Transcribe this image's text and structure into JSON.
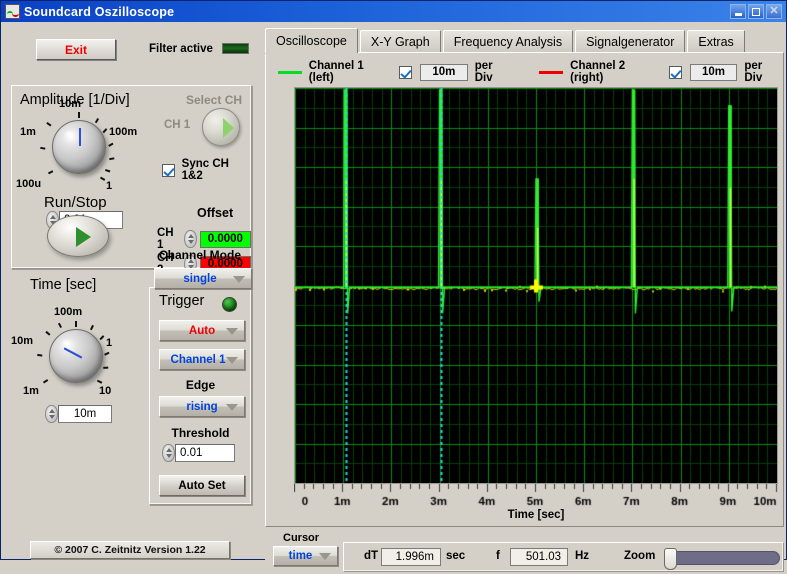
{
  "window": {
    "title": "Soundcard Oszilloscope",
    "icon": "oscilloscope-icon",
    "minimize": "minimize-icon",
    "maximize": "maximize-icon",
    "close": "close-icon"
  },
  "toolbar": {
    "exit_label": "Exit",
    "filter_label": "Filter active",
    "filter_led": "filter-led-off"
  },
  "amplitude": {
    "title": "Amplitude [1/Div]",
    "dial_labels": [
      "1m",
      "10m",
      "100m",
      "1",
      "100u"
    ],
    "value": "0.01",
    "select_ch_title": "Select CH",
    "select_ch_value": "CH 1",
    "sync_label": "Sync CH 1&2",
    "sync_checked": true,
    "offset_title": "Offset",
    "offsets": [
      {
        "label": "CH 1",
        "value": "0.0000",
        "color": "#00ff00"
      },
      {
        "label": "CH 2",
        "value": "0.0000",
        "color": "#ff0000"
      }
    ]
  },
  "time": {
    "title": "Time [sec]",
    "dial_labels": [
      "10m",
      "100m",
      "1",
      "10",
      "1m"
    ],
    "value": "10m"
  },
  "trigger": {
    "title": "Trigger",
    "led": "trigger-led-on",
    "mode": "Auto",
    "mode_color": "#ee0000",
    "source": "Channel 1",
    "source_color": "#0044dd",
    "edge_label": "Edge",
    "edge": "rising",
    "edge_color": "#0044dd",
    "threshold_label": "Threshold",
    "threshold": "0.01",
    "autoset_label": "Auto Set"
  },
  "runstop": {
    "label": "Run/Stop"
  },
  "channel_mode": {
    "label": "Channel Mode",
    "value": "single",
    "value_color": "#0044dd"
  },
  "footer": {
    "copyright": "© 2007   C. Zeitnitz Version 1.22"
  },
  "tabs": [
    {
      "label": "Oscilloscope",
      "active": true
    },
    {
      "label": "X-Y Graph",
      "active": false
    },
    {
      "label": "Frequency Analysis",
      "active": false
    },
    {
      "label": "Signalgenerator",
      "active": false
    },
    {
      "label": "Extras",
      "active": false
    }
  ],
  "channels": [
    {
      "name": "Channel 1 (left)",
      "color": "#00dd22",
      "enabled": true,
      "per_div_value": "10m",
      "per_div_label": "per Div"
    },
    {
      "name": "Channel 2 (right)",
      "color": "#ee0000",
      "enabled": true,
      "per_div_value": "10m",
      "per_div_label": "per Div"
    }
  ],
  "status": {
    "cursor_label": "Cursor",
    "cursor_mode": "time",
    "cursor_mode_color": "#0044dd",
    "dt_label": "dT",
    "dt_value": "1.996m",
    "dt_unit": "sec",
    "f_label": "f",
    "f_value": "501.03",
    "f_unit": "Hz",
    "zoom_label": "Zoom",
    "zoom_position": 0
  },
  "chart_data": {
    "type": "line",
    "title": "",
    "xlabel": "Time [sec]",
    "ylabel": "",
    "xlim": [
      0,
      0.01
    ],
    "x_tick_labels": [
      "0",
      "1m",
      "2m",
      "3m",
      "4m",
      "5m",
      "6m",
      "7m",
      "8m",
      "9m",
      "10m"
    ],
    "x_tick_values": [
      0,
      0.001,
      0.002,
      0.003,
      0.004,
      0.005,
      0.006,
      0.007,
      0.008,
      0.009,
      0.01
    ],
    "grid": true,
    "grid_major_color": "#0a8f12",
    "grid_minor_color": "#063f09",
    "background": "#000000",
    "divisions_x": 10,
    "divisions_y": 10,
    "baseline_y_frac": 0.505,
    "series": [
      {
        "name": "Channel 1 (left)",
        "color": "#2fee2f",
        "spikes_time": [
          0.00105,
          0.00302,
          0.00502,
          0.00702,
          0.00902
        ],
        "spike_amplitude_frac": [
          1.0,
          1.0,
          0.55,
          1.0,
          0.92
        ],
        "description": "periodic narrow pulses, period approx 2ms, 501 Hz"
      },
      {
        "name": "Channel 2 (right)",
        "color": "#cccc00",
        "spikes_time": [
          0.00502
        ],
        "spike_amplitude_frac": [
          0.12
        ],
        "description": "low-level noisy flat trace near baseline"
      }
    ],
    "cursors": [
      {
        "name": "cursor-1",
        "time": 0.00105,
        "color": "#22dddd"
      },
      {
        "name": "cursor-2",
        "time": 0.00302,
        "color": "#22dddd"
      }
    ],
    "cursor_marker": {
      "name": "cursor-marker",
      "time": 0.005,
      "color": "#ffff00"
    }
  }
}
